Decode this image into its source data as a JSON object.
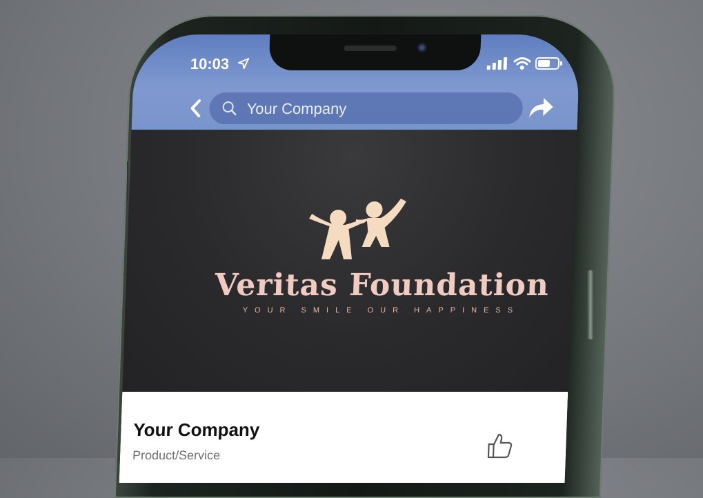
{
  "status_bar": {
    "time": "10:03",
    "icons": [
      "location-arrow-icon",
      "signal-icon",
      "wifi-icon",
      "battery-icon"
    ]
  },
  "nav": {
    "back_icon": "chevron-left-icon",
    "search_value": "Your Company",
    "share_icon": "share-arrow-icon"
  },
  "cover": {
    "logo_icon": "two-children-logo",
    "title": "Veritas Foundation",
    "tagline": "YOUR SMILE OUR HAPPINESS"
  },
  "profile": {
    "name": "Your Company",
    "category": "Product/Service",
    "like_icon": "thumbs-up-icon"
  },
  "colors": {
    "nav_bar": "#7f99d0",
    "cover_bg": "#2b2b2d",
    "logo": "#f5dcc0",
    "title": "#f1cbc0"
  }
}
